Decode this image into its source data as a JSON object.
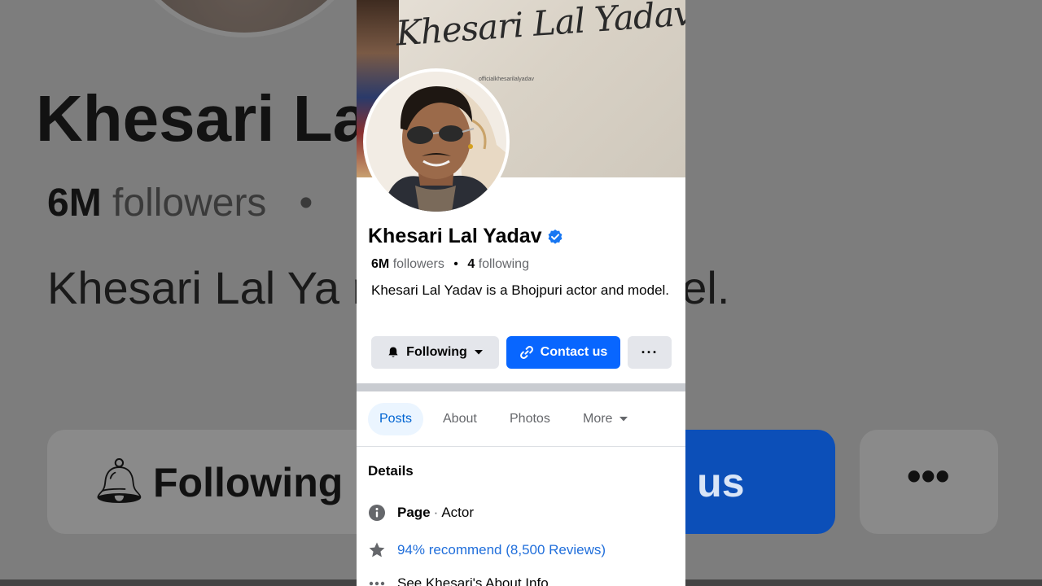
{
  "background": {
    "name": "Khesari La",
    "followers_count": "6M",
    "followers_word": "followers",
    "bio": "Khesari Lal Ya                      ri actor and model.",
    "following_label": "Following",
    "contact_partial": "act us",
    "more_glyph": "•••"
  },
  "cover": {
    "signature": "Khesari Lal Yadav",
    "handle": "officialkhesarilalyadav"
  },
  "profile": {
    "name": "Khesari Lal Yadav",
    "verified": true,
    "followers_count": "6M",
    "followers_label": "followers",
    "following_count": "4",
    "following_label": "following",
    "bio": "Khesari Lal Yadav is a Bhojpuri actor and model."
  },
  "actions": {
    "following_label": "Following",
    "contact_label": "Contact us",
    "more_label": "···"
  },
  "tabs": [
    {
      "label": "Posts",
      "active": true
    },
    {
      "label": "About",
      "active": false
    },
    {
      "label": "Photos",
      "active": false
    },
    {
      "label": "More",
      "active": false
    }
  ],
  "details": {
    "title": "Details",
    "page_label": "Page",
    "page_category": "Actor",
    "recommend": "94% recommend (8,500 Reviews)",
    "about_info": "See Khesari's About Info"
  },
  "colors": {
    "accent": "#0866ff",
    "link": "#216fdb",
    "active_tab_bg": "#ebf5ff"
  }
}
